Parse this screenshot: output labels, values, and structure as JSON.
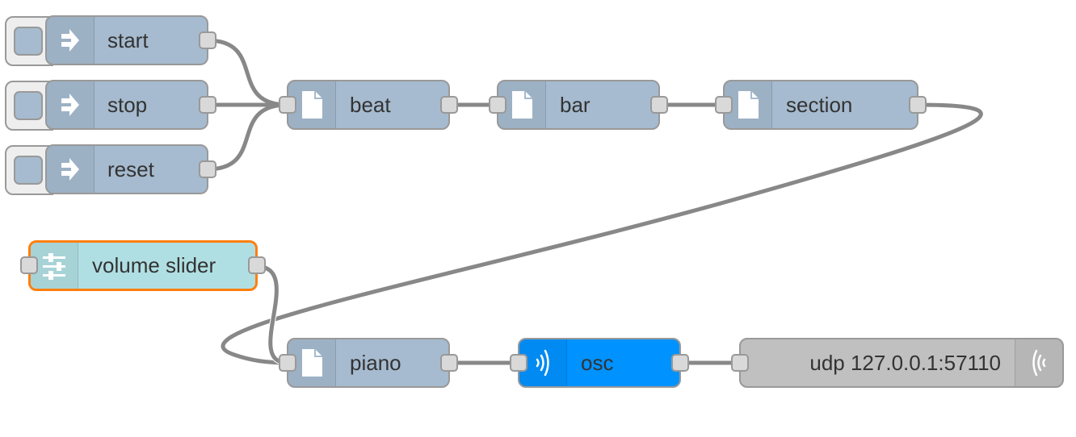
{
  "flow": {
    "nodes": [
      {
        "id": "start",
        "type": "inject",
        "label": "start",
        "icon": "arrow-in-icon",
        "color": "#a6bbcf"
      },
      {
        "id": "stop",
        "type": "inject",
        "label": "stop",
        "icon": "arrow-in-icon",
        "color": "#a6bbcf"
      },
      {
        "id": "reset",
        "type": "inject",
        "label": "reset",
        "icon": "arrow-in-icon",
        "color": "#a6bbcf"
      },
      {
        "id": "beat",
        "type": "function",
        "label": "beat",
        "icon": "file-icon",
        "color": "#a6bbcf"
      },
      {
        "id": "bar",
        "type": "function",
        "label": "bar",
        "icon": "file-icon",
        "color": "#a6bbcf"
      },
      {
        "id": "section",
        "type": "function",
        "label": "section",
        "icon": "file-icon",
        "color": "#a6bbcf"
      },
      {
        "id": "volume",
        "type": "ui_slider",
        "label": "volume slider",
        "icon": "sliders-icon",
        "color": "#b0dfe3",
        "selected": true
      },
      {
        "id": "piano",
        "type": "function",
        "label": "piano",
        "icon": "file-icon",
        "color": "#a6bbcf"
      },
      {
        "id": "osc",
        "type": "osc",
        "label": "osc",
        "icon": "bridge-icon",
        "color": "#0092ff"
      },
      {
        "id": "udp",
        "type": "udp out",
        "label": "udp 127.0.0.1:57110",
        "icon": "bridge-icon",
        "color": "#c0c0c0"
      }
    ],
    "wires": [
      [
        "start",
        "beat"
      ],
      [
        "stop",
        "beat"
      ],
      [
        "reset",
        "beat"
      ],
      [
        "beat",
        "bar"
      ],
      [
        "bar",
        "section"
      ],
      [
        "section",
        "piano"
      ],
      [
        "volume",
        "piano"
      ],
      [
        "piano",
        "osc"
      ],
      [
        "osc",
        "udp"
      ]
    ],
    "colors": {
      "wire": "#888888",
      "selected_border": "#ff7f0e",
      "node_border": "#999999",
      "port_fill": "#d9d9d9"
    }
  }
}
